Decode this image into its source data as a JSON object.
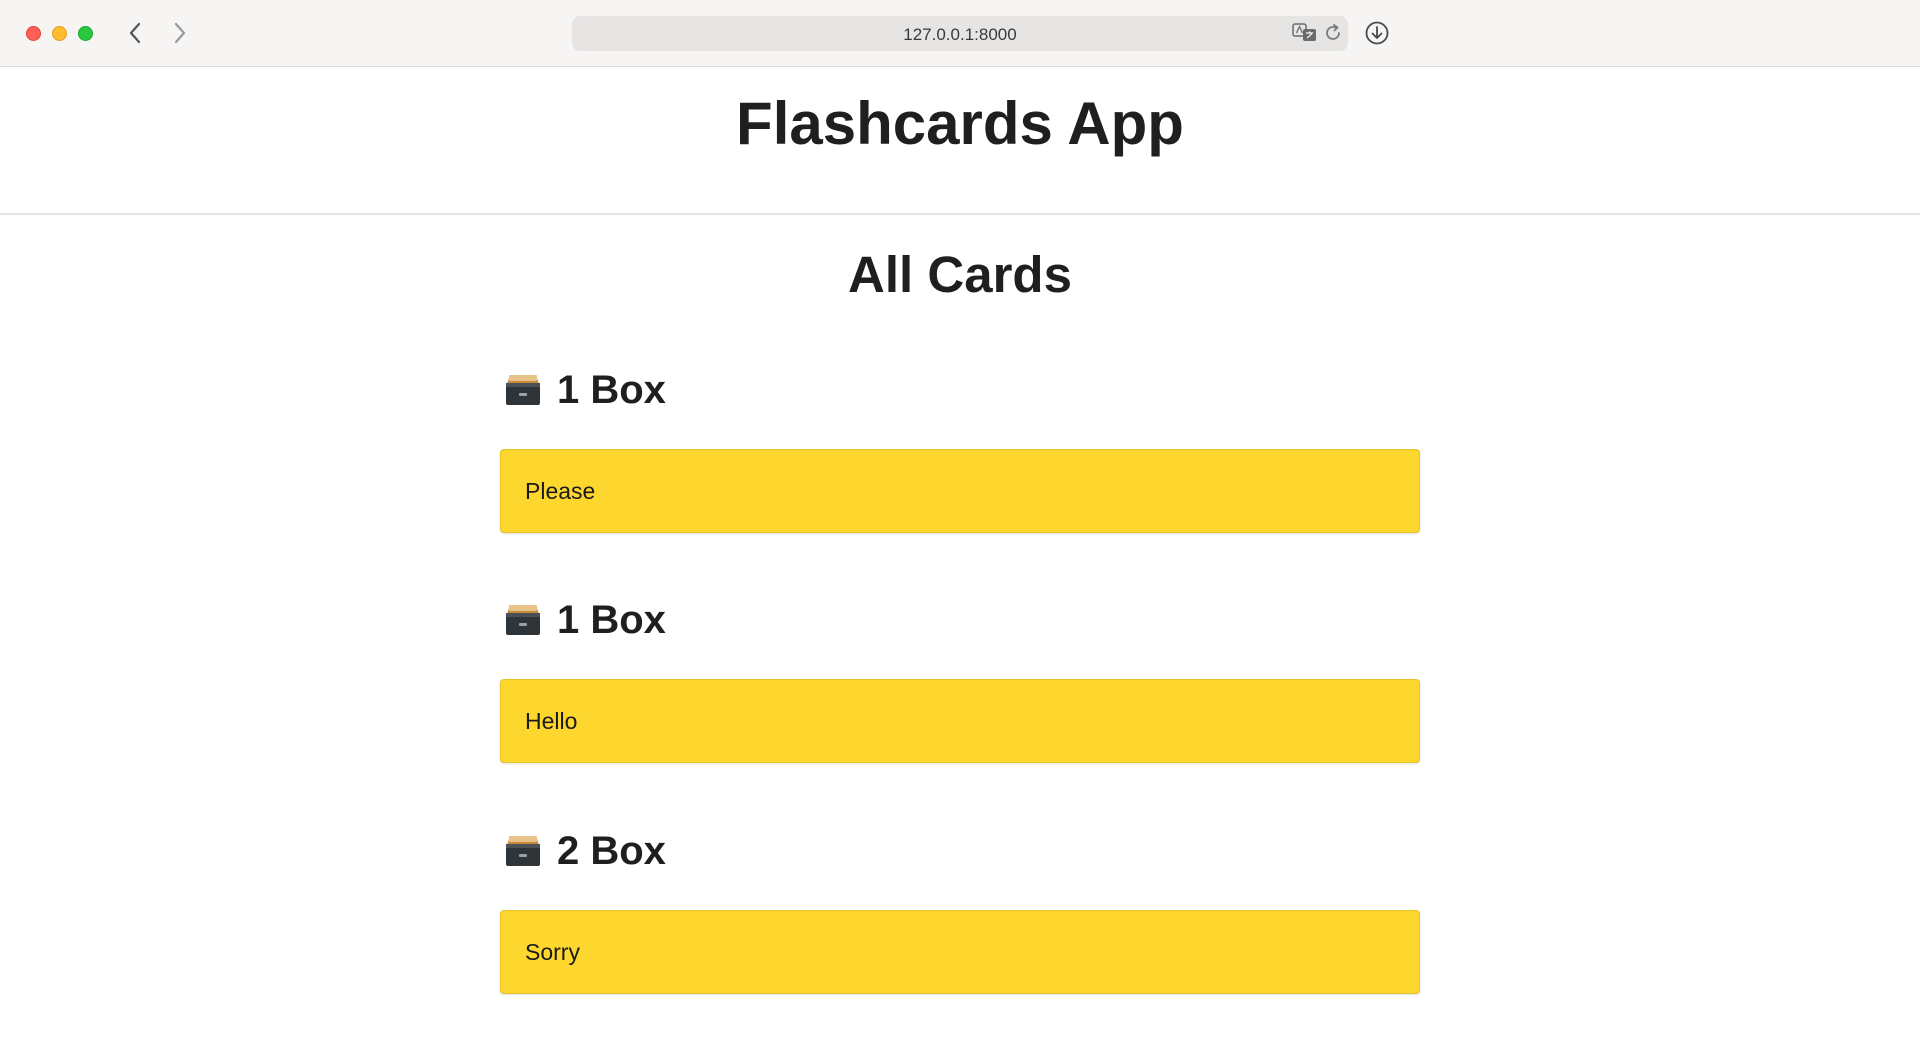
{
  "browser": {
    "url": "127.0.0.1:8000"
  },
  "app": {
    "title": "Flashcards App"
  },
  "main": {
    "section_title": "All Cards",
    "groups": [
      {
        "heading": "1 Box",
        "icon": "card-file-box-icon",
        "card_text": "Please"
      },
      {
        "heading": "1 Box",
        "icon": "card-file-box-icon",
        "card_text": "Hello"
      },
      {
        "heading": "2 Box",
        "icon": "card-file-box-icon",
        "card_text": "Sorry"
      }
    ]
  },
  "colors": {
    "card_background": "#fdd72e",
    "header_border": "#e4e4e4",
    "toolbar_background": "#f6f5f4"
  }
}
